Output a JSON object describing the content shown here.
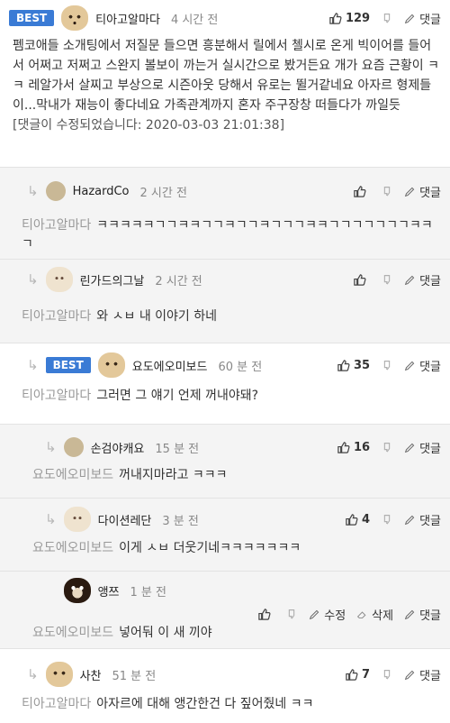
{
  "post": {
    "badge": "BEST",
    "author": "티아고알마다",
    "time": "4 시간 전",
    "likes": "129",
    "reply_label": "댓글",
    "text": "펨코애들 소개팅에서 저질문 들으면 흥분해서 릴에서 첼시로 온게 빅이어를 들어서 어쩌고 저쩌고 스완지 볼보이 까는거 실시간으로 봤거든요 개가 요즘 근황이 ㅋㅋ 레알가서 살찌고 부상으로 시즌아웃 당해서 유로는 뛸거같네요 아자르 형제들이...막내가 재능이 좋다네요 가족관계까지 혼자 주구장창 떠들다가 까일듯",
    "edited": "[댓글이 수정되었습니다: 2020-03-03 21:01:38]"
  },
  "comments": [
    {
      "author": "HazardCo",
      "time": "2 시간 전",
      "likes": "",
      "mention": "티아고알마다",
      "text": "ㅋㅋㅋㅋㅋㄱㄱㅋㅋㄱㄱㅋㄱㄱㅋㄱㄱㄱㅋㅋㄱㄱㄱㄱㄱㄱㄱㅋㅋ ㄱ",
      "reply_label": "댓글"
    },
    {
      "author": "린가드의그날",
      "time": "2 시간 전",
      "likes": "",
      "mention": "티아고알마다",
      "text": "와 ㅅㅂ 내 이야기 하네",
      "reply_label": "댓글"
    },
    {
      "badge": "BEST",
      "author": "요도에오미보드",
      "time": "60 분 전",
      "likes": "35",
      "mention": "티아고알마다",
      "text": "그러면 그 얘기 언제 꺼내야돼?",
      "reply_label": "댓글"
    },
    {
      "author": "손검야캐요",
      "time": "15 분 전",
      "likes": "16",
      "mention": "요도에오미보드",
      "text": "꺼내지마라고 ㅋㅋㅋ",
      "reply_label": "댓글"
    },
    {
      "author": "다이션레단",
      "time": "3 분 전",
      "likes": "4",
      "mention": "요도에오미보드",
      "text": "이게 ㅅㅂ 더웃기네ㅋㅋㅋㅋㅋㅋㅋ",
      "reply_label": "댓글"
    },
    {
      "author": "앵쯔",
      "time": "1 분 전",
      "likes": "",
      "mention": "요도에오미보드",
      "text": "넣어둬 이 새 끼야",
      "reply_label": "댓글",
      "edit_label": "수정",
      "delete_label": "삭제"
    },
    {
      "author": "사찬",
      "time": "51 분 전",
      "likes": "7",
      "mention": "티아고알마다",
      "text": "아자르에 대해 앵간한건 다 짚어줬네 ㅋㅋ",
      "reply_label": "댓글"
    }
  ],
  "colors": {
    "best_badge": "#3a7bd5",
    "reply_bg": "#f4f4f4"
  },
  "icons": {
    "reply_arrow": "reply-arrow-icon",
    "like": "thumbs-up-icon",
    "dislike": "thumbs-down-icon",
    "reply": "pencil-icon",
    "edit": "edit-icon",
    "delete": "eraser-icon"
  }
}
